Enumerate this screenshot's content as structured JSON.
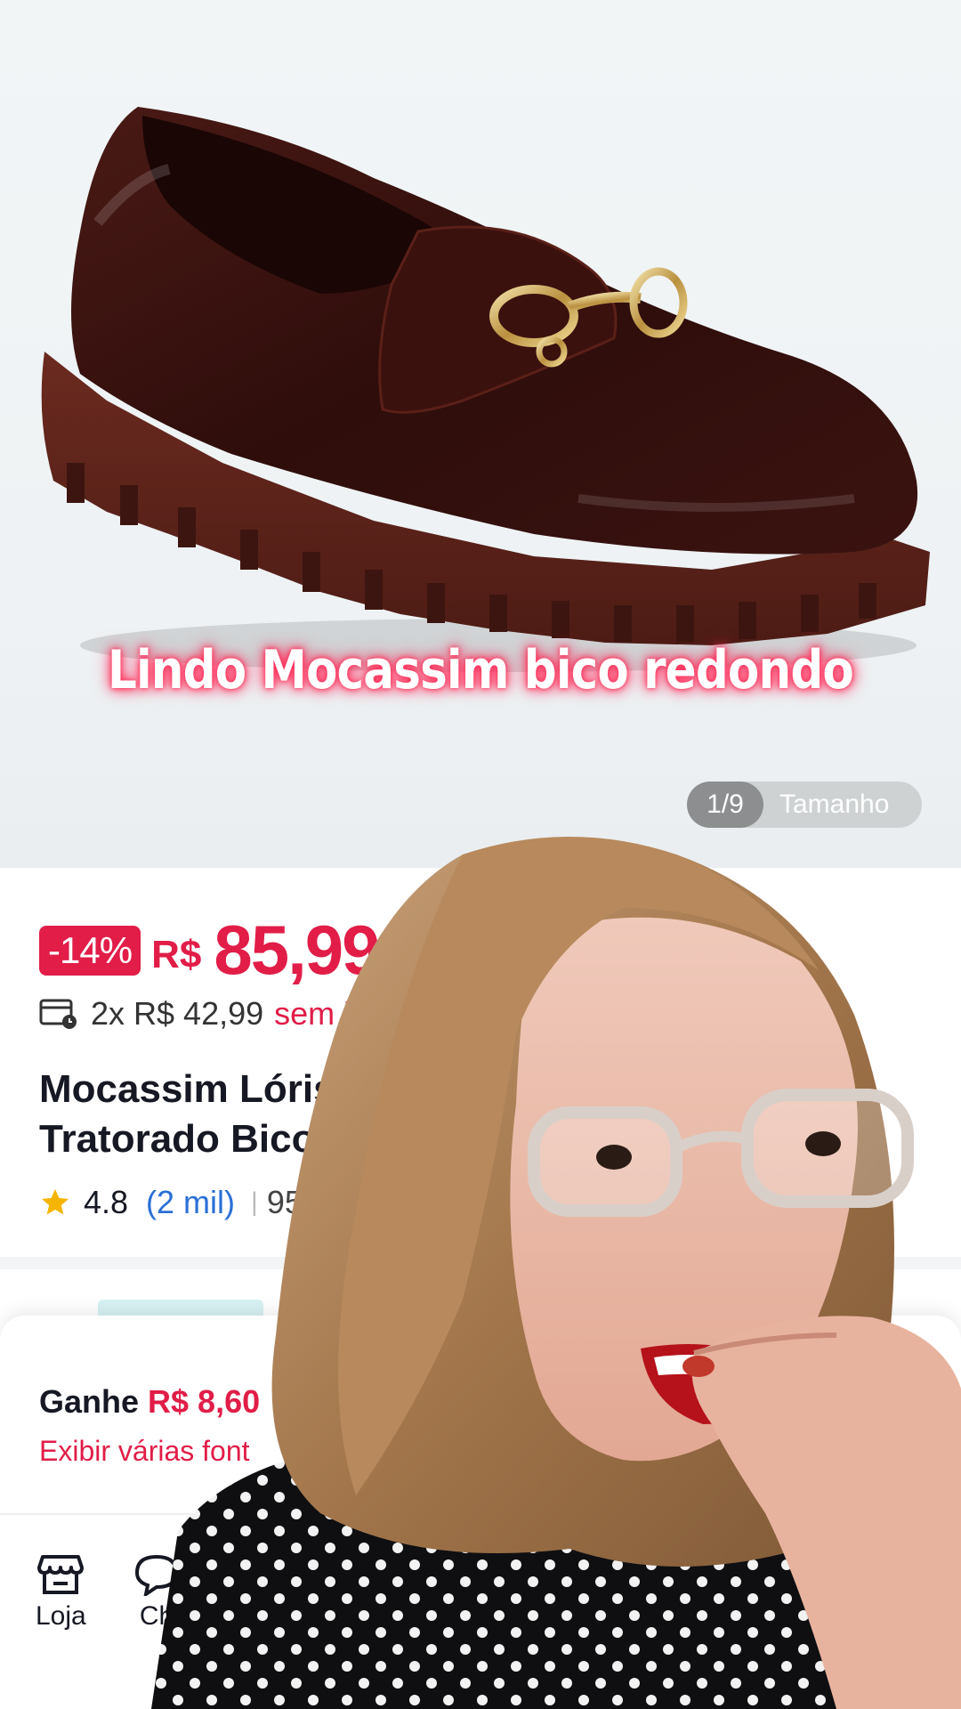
{
  "hero": {
    "caption": "Lindo Mocassim bico redondo",
    "counter_index": "1/9",
    "counter_label": "Tamanho"
  },
  "product": {
    "discount": "-14%",
    "currency": "R$",
    "price": "85,99",
    "installments": "2x R$ 42,99",
    "installments_suffix": "sem ju",
    "title_line1": "Mocassim Lóris S",
    "title_line2": "Tratorado Bico F",
    "rating": "4.8",
    "rating_count": "(2 mil)",
    "sold": "952"
  },
  "sheet": {
    "ganhe_label": "Ganhe",
    "ganhe_amount": "R$ 8,60",
    "exibir": "Exibir várias font"
  },
  "nav": {
    "loja": "Loja",
    "chat": "Ch"
  },
  "colors": {
    "accent": "#e11d48",
    "link": "#2a6fd6",
    "caption_glow": "#ff2a56"
  }
}
